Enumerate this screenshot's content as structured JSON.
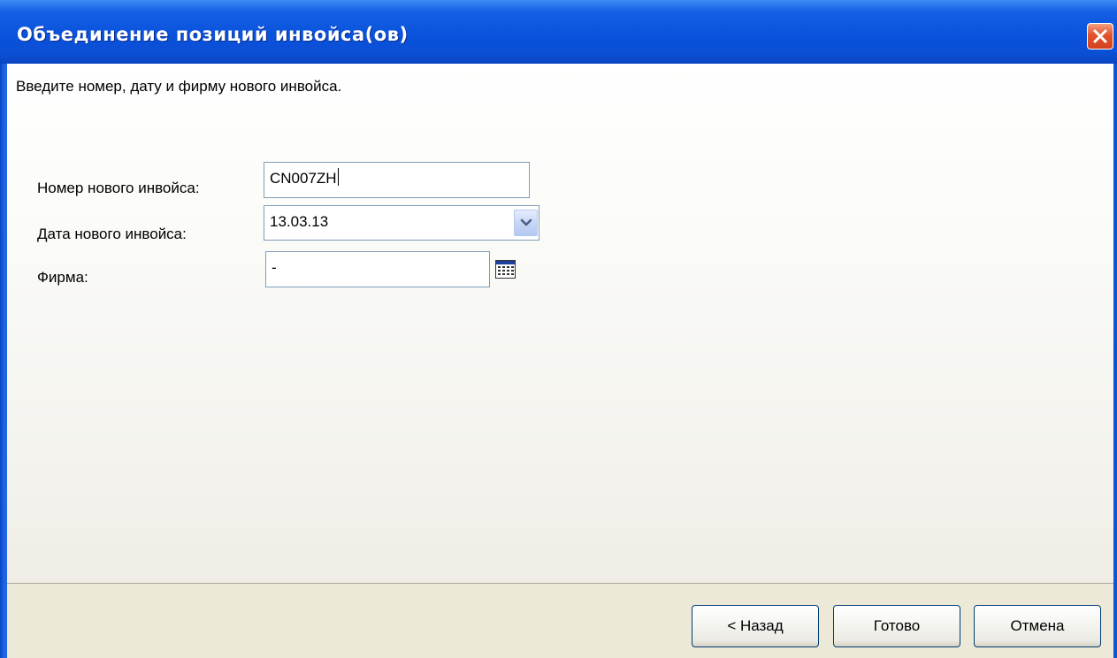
{
  "window": {
    "title": "Объединение позиций инвойса(ов)"
  },
  "content": {
    "instruction": "Введите номер, дату и фирму нового инвойса."
  },
  "form": {
    "invoice_number": {
      "label": "Номер нового инвойса:",
      "value": "CN007ZH"
    },
    "invoice_date": {
      "label": "Дата нового инвойса:",
      "value": "13.03.13"
    },
    "firm": {
      "label": "Фирма:",
      "value": "-"
    }
  },
  "buttons": {
    "back": "< Назад",
    "finish": "Готово",
    "cancel": "Отмена"
  },
  "colors": {
    "title_bar": "#0a52dc",
    "dialog_bg": "#ece9d8",
    "input_border": "#7f9db9",
    "close_button": "#d4421e",
    "button_border": "#003c74"
  },
  "icons": {
    "close": "close-icon",
    "dropdown": "chevron-down-icon",
    "calendar": "calendar-icon"
  }
}
